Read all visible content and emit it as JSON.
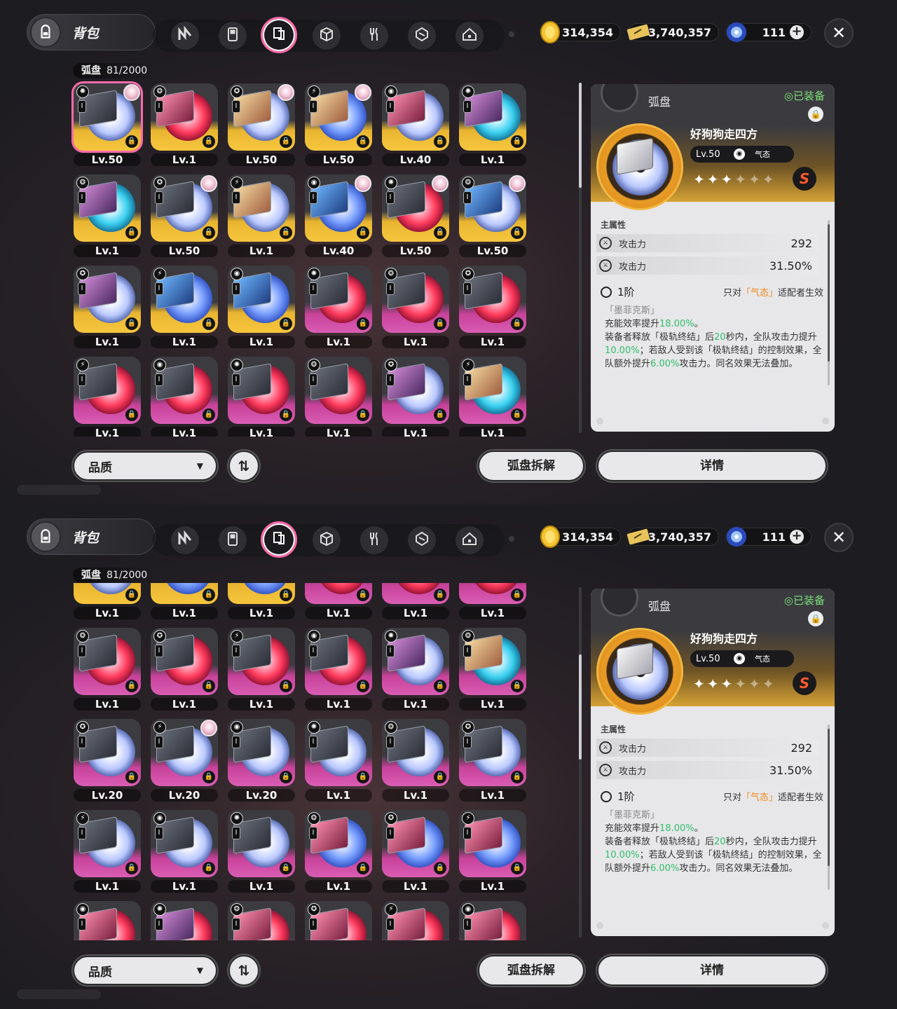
{
  "header": {
    "title": "背包",
    "tabs": [
      {
        "icon": "n-logo-icon"
      },
      {
        "icon": "gameboy-icon"
      },
      {
        "icon": "disc-icon",
        "active": true
      },
      {
        "icon": "cube-icon"
      },
      {
        "icon": "fork-knife-icon"
      },
      {
        "icon": "module-icon"
      },
      {
        "icon": "home-icon"
      }
    ],
    "currencies": [
      {
        "name": "coin",
        "value": "314,354"
      },
      {
        "name": "ticket",
        "value": "3,740,357"
      },
      {
        "name": "crystal",
        "value": "111"
      }
    ],
    "close_icon": "close-icon"
  },
  "inventory": {
    "category": "弧盘",
    "count": "81/2000"
  },
  "grid_top": [
    [
      {
        "lv": "Lv.50",
        "bg": "gold",
        "disc": "white",
        "box": "",
        "avatar": true,
        "sel": true
      },
      {
        "lv": "Lv.1",
        "bg": "gold",
        "disc": "red",
        "box": "c4"
      },
      {
        "lv": "Lv.50",
        "bg": "gold",
        "disc": "white",
        "box": "c2",
        "avatar": true
      },
      {
        "lv": "Lv.50",
        "bg": "gold",
        "disc": "blue",
        "box": "c2",
        "avatar": true
      },
      {
        "lv": "Lv.40",
        "bg": "gold",
        "disc": "white",
        "box": "c4"
      },
      {
        "lv": "Lv.1",
        "bg": "gold",
        "disc": "cyan",
        "box": "c1"
      }
    ],
    [
      {
        "lv": "Lv.1",
        "bg": "gold",
        "disc": "cyan",
        "box": "c1"
      },
      {
        "lv": "Lv.50",
        "bg": "gold",
        "disc": "white",
        "box": "",
        "avatar": true
      },
      {
        "lv": "Lv.1",
        "bg": "gold",
        "disc": "white",
        "box": "c2"
      },
      {
        "lv": "Lv.40",
        "bg": "gold",
        "disc": "blue",
        "box": "c3",
        "avatar": true
      },
      {
        "lv": "Lv.50",
        "bg": "gold",
        "disc": "red",
        "box": "",
        "avatar": true
      },
      {
        "lv": "Lv.50",
        "bg": "gold",
        "disc": "white",
        "box": "c3",
        "avatar": true
      }
    ],
    [
      {
        "lv": "Lv.1",
        "bg": "gold",
        "disc": "white",
        "box": "c1"
      },
      {
        "lv": "Lv.1",
        "bg": "gold",
        "disc": "blue",
        "box": "c3"
      },
      {
        "lv": "Lv.1",
        "bg": "gold",
        "disc": "blue",
        "box": "c3"
      },
      {
        "lv": "Lv.1",
        "bg": "pink",
        "disc": "red",
        "box": ""
      },
      {
        "lv": "Lv.1",
        "bg": "pink",
        "disc": "red",
        "box": ""
      },
      {
        "lv": "Lv.1",
        "bg": "pink",
        "disc": "red",
        "box": ""
      }
    ],
    [
      {
        "lv": "Lv.1",
        "bg": "pink",
        "disc": "red",
        "box": ""
      },
      {
        "lv": "Lv.1",
        "bg": "pink",
        "disc": "red",
        "box": ""
      },
      {
        "lv": "Lv.1",
        "bg": "pink",
        "disc": "red",
        "box": ""
      },
      {
        "lv": "Lv.1",
        "bg": "pink",
        "disc": "red",
        "box": ""
      },
      {
        "lv": "Lv.1",
        "bg": "pink",
        "disc": "white",
        "box": "c1"
      },
      {
        "lv": "Lv.1",
        "bg": "pink",
        "disc": "cyan",
        "box": "c2"
      }
    ]
  ],
  "grid_bottom": [
    [
      {
        "lv": "Lv.1",
        "bg": "gold",
        "disc": "white",
        "box": "c1"
      },
      {
        "lv": "Lv.1",
        "bg": "gold",
        "disc": "blue",
        "box": "c3"
      },
      {
        "lv": "Lv.1",
        "bg": "gold",
        "disc": "blue",
        "box": "c3"
      },
      {
        "lv": "Lv.1",
        "bg": "pink",
        "disc": "red",
        "box": ""
      },
      {
        "lv": "Lv.1",
        "bg": "pink",
        "disc": "red",
        "box": ""
      },
      {
        "lv": "Lv.1",
        "bg": "pink",
        "disc": "red",
        "box": ""
      }
    ],
    [
      {
        "lv": "Lv.1",
        "bg": "pink",
        "disc": "red",
        "box": ""
      },
      {
        "lv": "Lv.1",
        "bg": "pink",
        "disc": "red",
        "box": ""
      },
      {
        "lv": "Lv.1",
        "bg": "pink",
        "disc": "red",
        "box": ""
      },
      {
        "lv": "Lv.1",
        "bg": "pink",
        "disc": "red",
        "box": ""
      },
      {
        "lv": "Lv.1",
        "bg": "pink",
        "disc": "white",
        "box": "c1"
      },
      {
        "lv": "Lv.1",
        "bg": "pink",
        "disc": "cyan",
        "box": "c2"
      }
    ],
    [
      {
        "lv": "Lv.20",
        "bg": "pink",
        "disc": "white",
        "box": ""
      },
      {
        "lv": "Lv.20",
        "bg": "pink",
        "disc": "white",
        "box": "",
        "avatar": true
      },
      {
        "lv": "Lv.20",
        "bg": "pink",
        "disc": "white",
        "box": ""
      },
      {
        "lv": "Lv.1",
        "bg": "pink",
        "disc": "white",
        "box": ""
      },
      {
        "lv": "Lv.1",
        "bg": "pink",
        "disc": "white",
        "box": ""
      },
      {
        "lv": "Lv.1",
        "bg": "pink",
        "disc": "white",
        "box": ""
      }
    ],
    [
      {
        "lv": "Lv.1",
        "bg": "pink",
        "disc": "white",
        "box": ""
      },
      {
        "lv": "Lv.1",
        "bg": "pink",
        "disc": "white",
        "box": ""
      },
      {
        "lv": "Lv.1",
        "bg": "pink",
        "disc": "white",
        "box": ""
      },
      {
        "lv": "Lv.1",
        "bg": "pink",
        "disc": "blue",
        "box": "c4"
      },
      {
        "lv": "Lv.1",
        "bg": "pink",
        "disc": "blue",
        "box": "c4"
      },
      {
        "lv": "Lv.1",
        "bg": "pink",
        "disc": "blue",
        "box": "c4"
      }
    ],
    [
      {
        "lv": "",
        "bg": "pink",
        "disc": "red",
        "box": "c4"
      },
      {
        "lv": "",
        "bg": "pink",
        "disc": "red",
        "box": "c1"
      },
      {
        "lv": "",
        "bg": "pink",
        "disc": "red",
        "box": "c4"
      },
      {
        "lv": "",
        "bg": "pink",
        "disc": "red",
        "box": "c4"
      },
      {
        "lv": "",
        "bg": "pink",
        "disc": "red",
        "box": "c4"
      },
      {
        "lv": "",
        "bg": "pink",
        "disc": "red",
        "box": "c4"
      }
    ]
  ],
  "detail": {
    "category": "弧盘",
    "equipped": "◎已装备",
    "name": "好狗狗走四方",
    "level": "Lv.50",
    "sub_attr": "气态",
    "stars_filled": 3,
    "stars_total": 6,
    "rank": "S",
    "main_attr_label": "主属性",
    "stats": [
      {
        "label": "攻击力",
        "value": "292"
      },
      {
        "label": "攻击力",
        "value": "31.50%"
      }
    ],
    "tier": "1阶",
    "tier_note_pre": "只对",
    "tier_note_hl": "「气态」",
    "tier_note_post": "适配者生效",
    "effect_title": "「墨菲克斯」",
    "effect_line1_pre": "充能效率提升",
    "effect_line1_val": "18.00%",
    "effect_line1_post": "。",
    "effect_p1": "装备者释放「极轨终结」后",
    "effect_v1": "20",
    "effect_p2": "秒内，全队攻击力提升",
    "effect_v2": "10.00%",
    "effect_p3": "；若敌人受到该「极轨终结」的控制效果，全队额外提升",
    "effect_v3": "6.00%",
    "effect_p4": "攻击力。同名效果无法叠加。"
  },
  "footer": {
    "filter_label": "品质",
    "sort_icon": "sort-icon",
    "dismantle_label": "弧盘拆解",
    "details_label": "详情"
  }
}
